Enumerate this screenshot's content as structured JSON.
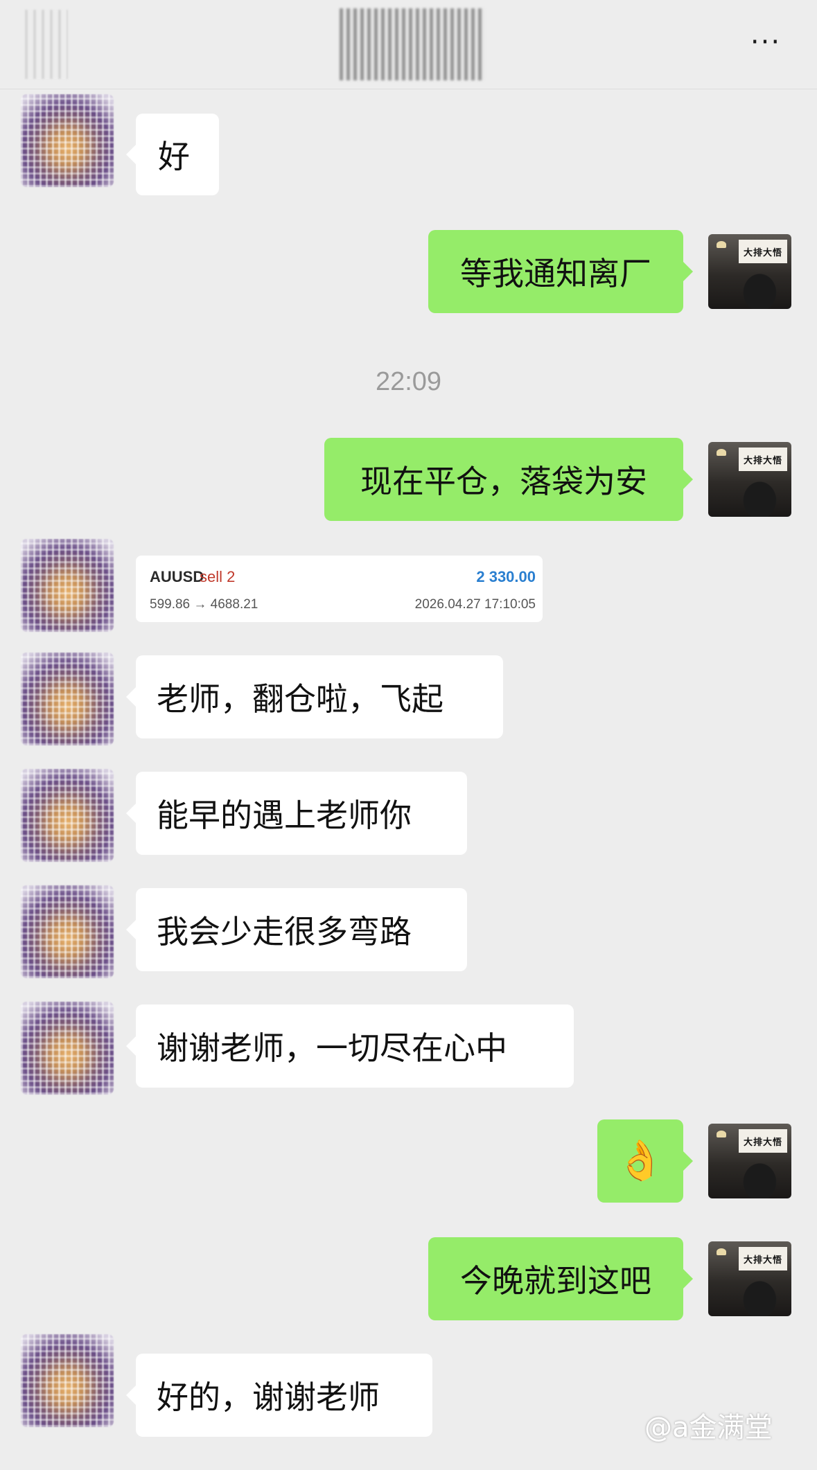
{
  "header": {
    "more_icon": "more-dots-icon",
    "more_label": "···"
  },
  "messages": [
    {
      "side": "left",
      "text": "好"
    },
    {
      "side": "right",
      "text": "等我通知离厂"
    },
    {
      "side": "right",
      "text": "现在平仓，落袋为安"
    },
    {
      "side": "left",
      "text": "老师，翻仓啦，飞起"
    },
    {
      "side": "left",
      "text": "能早的遇上老师你"
    },
    {
      "side": "left",
      "text": "我会少走很多弯路"
    },
    {
      "side": "left",
      "text": "谢谢老师，一切尽在心中"
    },
    {
      "side": "right",
      "text": "👌"
    },
    {
      "side": "right",
      "text": "今晚就到这吧"
    },
    {
      "side": "left",
      "text": "好的，谢谢老师"
    }
  ],
  "time_divider": "22:09",
  "trade_card": {
    "symbol": "AUUSD",
    "side": "sell 2",
    "profit": "2 330.00",
    "price": "599.86 → 4688.21",
    "datetime": "2026.04.27 17:10:05"
  },
  "avatar_right_sign": "大排大悟",
  "watermark": "@a金满堂",
  "colors": {
    "sent_bubble": "#95ec69",
    "received_bubble": "#ffffff",
    "background": "#ededed",
    "profit": "#2a7fd0",
    "sell": "#c0392b"
  }
}
